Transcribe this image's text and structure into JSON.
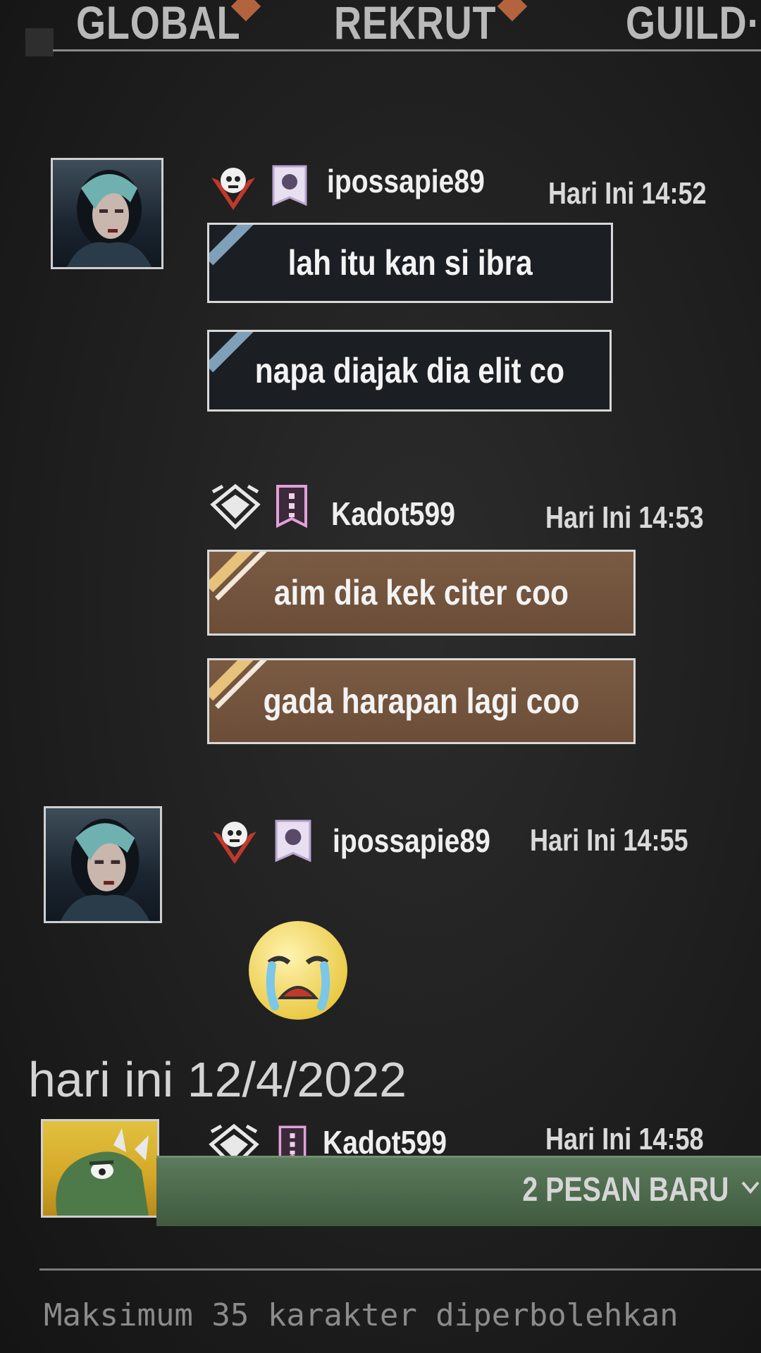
{
  "tabs": [
    {
      "label": "GLOBAL"
    },
    {
      "label": "REKRUT"
    },
    {
      "label": "GUILD·"
    }
  ],
  "messages": [
    {
      "username": "ipossapie89",
      "time": "Hari Ini 14:52",
      "bubbles": [
        "lah itu kan si ibra",
        "napa diajak dia elit co"
      ]
    },
    {
      "username": "Kadot599",
      "time": "Hari Ini 14:53",
      "bubbles": [
        "aim dia kek citer coo",
        "gada harapan lagi coo"
      ]
    },
    {
      "username": "ipossapie89",
      "time": "Hari Ini 14:55",
      "emoji": "crying-face"
    },
    {
      "username": "Kadot599",
      "time": "Hari Ini 14:58"
    }
  ],
  "date_divider": "hari ini 12/4/2022",
  "new_messages": {
    "label": "2 PESAN BARU",
    "icon": "chevron-down-icon"
  },
  "input": {
    "placeholder": "Maksimum 35 karakter diperbolehkan",
    "value": ""
  },
  "colors": {
    "tab_diamond": "#b3643e",
    "bubble_dark": "#1b1e22",
    "bubble_brown": "#6c4e38",
    "new_bar": "#4a664a"
  }
}
